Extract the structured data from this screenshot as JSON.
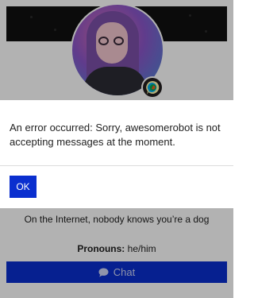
{
  "dialog": {
    "message": "An error occurred: Sorry, awesomerobot is not accepting messages at the moment.",
    "ok_label": "OK"
  },
  "profile": {
    "tagline": "On the Internet, nobody knows you’re a dog",
    "pronouns_label": "Pronouns:",
    "pronouns_value": "he/him",
    "chat_label": "Chat",
    "chat_icon": "chat-bubble-icon",
    "badge_icon": "discourse-badge-icon"
  },
  "colors": {
    "primary": "#0a2fcf",
    "overlay": "rgba(0,0,0,0.30)"
  }
}
